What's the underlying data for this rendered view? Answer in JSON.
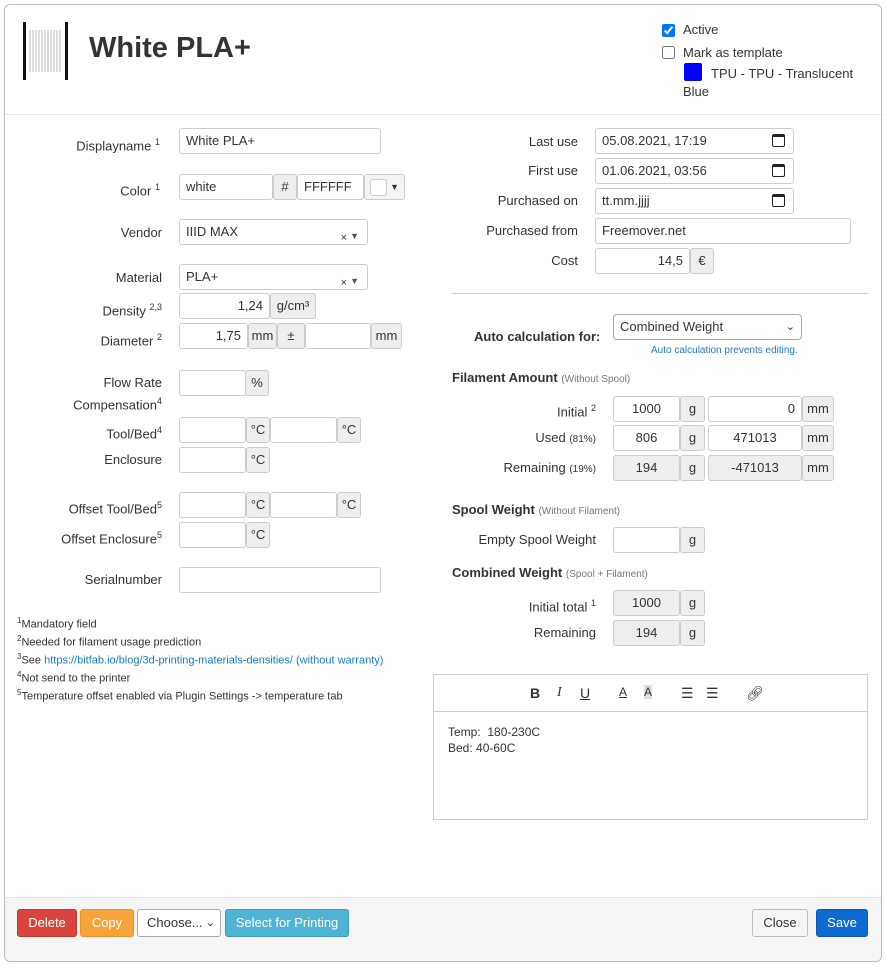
{
  "header": {
    "title": "White PLA+",
    "active_label": "Active",
    "active_checked": true,
    "template_label": "Mark as template",
    "template_checked": false,
    "template_name_line1": "TPU - TPU - Translucent",
    "template_name_line2": "Blue",
    "template_color": "#0000ff",
    "spool_icon": "spool-icon"
  },
  "left": {
    "displayname": {
      "label": "Displayname",
      "sup": "1",
      "value": "White PLA+"
    },
    "color": {
      "label": "Color",
      "sup": "1",
      "name": "white",
      "hash": "#",
      "hex": "FFFFFF",
      "swatch": "#ffffff"
    },
    "vendor": {
      "label": "Vendor",
      "value": "IIID MAX",
      "clear": "×"
    },
    "material": {
      "label": "Material",
      "value": "PLA+",
      "clear": "×"
    },
    "density": {
      "label": "Density",
      "sup": "2,3",
      "value": "1,24",
      "unit": "g/cm³"
    },
    "diameter": {
      "label": "Diameter",
      "sup": "2",
      "value": "1,75",
      "unit": "mm",
      "tol_sign": "±",
      "tol_value": "",
      "tol_unit": "mm"
    },
    "flow": {
      "label1": "Flow Rate",
      "label2": "Compensation",
      "sup": "4",
      "value": "",
      "unit": "%"
    },
    "toolbed": {
      "label": "Tool/Bed",
      "sup": "4",
      "tool": "",
      "bed": "",
      "unit": "°C"
    },
    "enclosure": {
      "label": "Enclosure",
      "value": "",
      "unit": "°C"
    },
    "offset_toolbed": {
      "label": "Offset Tool/Bed",
      "sup": "5",
      "tool": "",
      "bed": "",
      "unit": "°C"
    },
    "offset_enclosure": {
      "label": "Offset Enclosure",
      "sup": "5",
      "value": "",
      "unit": "°C"
    },
    "serial": {
      "label": "Serialnumber",
      "value": ""
    },
    "footnotes": [
      {
        "n": "1",
        "text": "Mandatory field"
      },
      {
        "n": "2",
        "text": "Needed for filament usage prediction"
      },
      {
        "n": "3",
        "text": "See ",
        "link": "https://bitfab.io/blog/3d-printing-materials-densities/ (without warranty)"
      },
      {
        "n": "4",
        "text": "Not send to the printer"
      },
      {
        "n": "5",
        "text": "Temperature offset enabled via Plugin Settings -> temperature tab"
      }
    ]
  },
  "right": {
    "last_use": {
      "label": "Last use",
      "value": "05.08.2021, 17:19"
    },
    "first_use": {
      "label": "First use",
      "value": "01.06.2021, 03:56"
    },
    "purchased_on": {
      "label": "Purchased on",
      "value": "tt.mm.jjjj"
    },
    "purchased_from": {
      "label": "Purchased from",
      "value": "Freemover.net"
    },
    "cost": {
      "label": "Cost",
      "value": "14,5",
      "unit": "€"
    },
    "auto": {
      "label": "Auto calculation for:",
      "value": "Combined Weight",
      "note": "Auto calculation prevents editing."
    },
    "filament": {
      "title": "Filament Amount",
      "sub": "(Without Spool)",
      "initial": {
        "label": "Initial",
        "sup": "2",
        "g": "1000",
        "mm": "0"
      },
      "used": {
        "label": "Used",
        "pct": "(81%)",
        "g": "806",
        "mm": "471013"
      },
      "remaining": {
        "label": "Remaining",
        "pct": "(19%)",
        "g": "194",
        "mm": "-471013"
      },
      "g": "g",
      "mm": "mm"
    },
    "spool": {
      "title": "Spool Weight",
      "sub": "(Without Filament)",
      "empty_label": "Empty Spool Weight",
      "empty_value": ""
    },
    "combined": {
      "title": "Combined Weight",
      "sub": "(Spool + Filament)",
      "initial_label": "Initial total",
      "initial_sup": "1",
      "initial_value": "1000",
      "remaining_label": "Remaining",
      "remaining_value": "194"
    },
    "editor": {
      "line1": "Temp:  180-230C",
      "line2": "Bed: 40-60C"
    }
  },
  "footer": {
    "delete": "Delete",
    "copy": "Copy",
    "choose": "Choose...",
    "select_printing": "Select for Printing",
    "close": "Close",
    "save": "Save"
  }
}
